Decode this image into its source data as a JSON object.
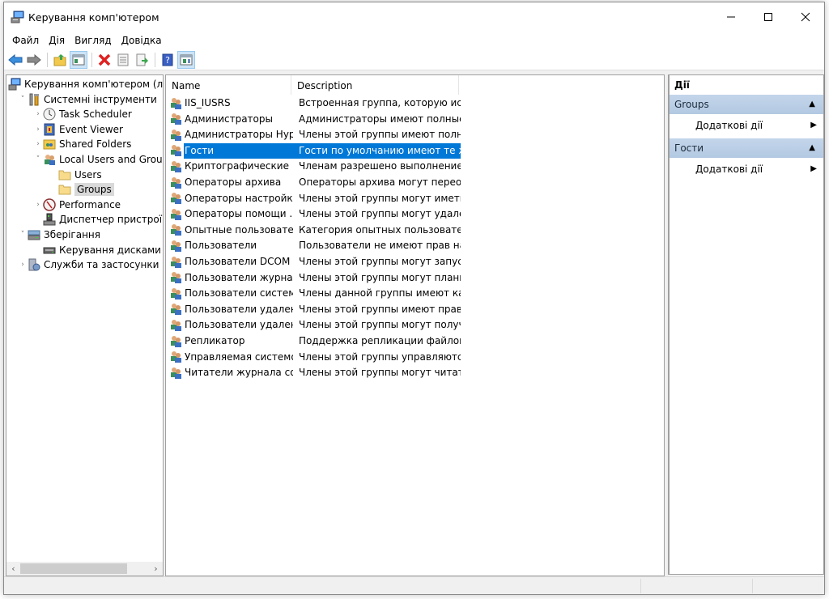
{
  "window": {
    "title": "Керування комп'ютером",
    "controls": {
      "minimize": "minimize",
      "maximize": "maximize",
      "close": "close"
    }
  },
  "menu": [
    "Файл",
    "Дія",
    "Вигляд",
    "Довідка"
  ],
  "toolbar": [
    {
      "icon": "back-arrow-icon",
      "tooltip": "Back"
    },
    {
      "icon": "forward-arrow-icon",
      "tooltip": "Forward"
    },
    {
      "icon": "up-folder-icon",
      "tooltip": "Up one level"
    },
    {
      "icon": "show-hide-tree-icon",
      "tooltip": "Show/Hide Console Tree",
      "pressed": true
    },
    {
      "icon": "delete-icon",
      "tooltip": "Delete"
    },
    {
      "icon": "properties-icon",
      "tooltip": "Properties"
    },
    {
      "icon": "export-list-icon",
      "tooltip": "Export List"
    },
    {
      "icon": "help-icon",
      "tooltip": "Help"
    },
    {
      "icon": "show-hide-action-pane-icon",
      "tooltip": "Show/Hide Action Pane",
      "pressed": true
    }
  ],
  "tree": [
    {
      "label": "Керування комп'ютером (локальний)",
      "level": 0,
      "expander": "",
      "icon": "computer-management-icon"
    },
    {
      "label": "Системні інструменти",
      "level": 1,
      "expander": "expanded",
      "icon": "system-tools-icon"
    },
    {
      "label": "Task Scheduler",
      "level": 2,
      "expander": "collapsed",
      "icon": "task-scheduler-icon"
    },
    {
      "label": "Event Viewer",
      "level": 2,
      "expander": "collapsed",
      "icon": "event-viewer-icon"
    },
    {
      "label": "Shared Folders",
      "level": 2,
      "expander": "collapsed",
      "icon": "shared-folders-icon"
    },
    {
      "label": "Local Users and Groups",
      "level": 2,
      "expander": "expanded",
      "icon": "local-users-groups-icon"
    },
    {
      "label": "Users",
      "level": 3,
      "expander": "",
      "icon": "folder-icon"
    },
    {
      "label": "Groups",
      "level": 3,
      "expander": "",
      "icon": "folder-icon",
      "selected": true
    },
    {
      "label": "Performance",
      "level": 2,
      "expander": "collapsed",
      "icon": "performance-icon"
    },
    {
      "label": "Диспетчер пристроїв",
      "level": 2,
      "expander": "",
      "icon": "device-manager-icon"
    },
    {
      "label": "Зберігання",
      "level": 1,
      "expander": "expanded",
      "icon": "storage-icon"
    },
    {
      "label": "Керування дисками",
      "level": 2,
      "expander": "",
      "icon": "disk-management-icon"
    },
    {
      "label": "Служби та застосунки",
      "level": 1,
      "expander": "collapsed",
      "icon": "services-applications-icon"
    }
  ],
  "list": {
    "columns": [
      "Name",
      "Description"
    ],
    "rows": [
      {
        "name": "IIS_IUSRS",
        "description": "Встроенная группа, которую исп..."
      },
      {
        "name": "Администраторы",
        "description": "Администраторы имеют полные, ..."
      },
      {
        "name": "Администраторы Hyp...",
        "description": "Члены этой группы имеют полн..."
      },
      {
        "name": "Гости",
        "description": "Гости по умолчанию имеют те ж...",
        "selected": true
      },
      {
        "name": "Криптографические ...",
        "description": "Членам разрешено выполнение ..."
      },
      {
        "name": "Операторы архива",
        "description": "Операторы архива могут переоп..."
      },
      {
        "name": "Операторы настройк...",
        "description": "Члены этой группы могут иметь ..."
      },
      {
        "name": "Операторы помощи ...",
        "description": "Члены этой группы могут удален..."
      },
      {
        "name": "Опытные пользовате...",
        "description": "Категория опытных пользовател..."
      },
      {
        "name": "Пользователи",
        "description": "Пользователи не имеют прав на ..."
      },
      {
        "name": "Пользователи DCOM",
        "description": "Члены этой группы могут запуск..."
      },
      {
        "name": "Пользователи журна...",
        "description": "Члены этой группы могут планир..."
      },
      {
        "name": "Пользователи систем...",
        "description": "Члены данной группы имеют как..."
      },
      {
        "name": "Пользователи удален...",
        "description": "Члены этой группы имеют право..."
      },
      {
        "name": "Пользователи удален...",
        "description": "Члены этой группы могут получа..."
      },
      {
        "name": "Репликатор",
        "description": "Поддержка репликации файлов ..."
      },
      {
        "name": "Управляемая системо...",
        "description": "Члены этой группы управляются ..."
      },
      {
        "name": "Читатели журнала со...",
        "description": "Члены этой группы могут читать ..."
      }
    ]
  },
  "actions": {
    "title": "Дії",
    "sections": [
      {
        "header": "Groups",
        "items": [
          "Додаткові дії"
        ]
      },
      {
        "header": "Гости",
        "items": [
          "Додаткові дії"
        ]
      }
    ]
  },
  "colors": {
    "selection": "#0078d7",
    "action_section": "#b8cce4"
  }
}
